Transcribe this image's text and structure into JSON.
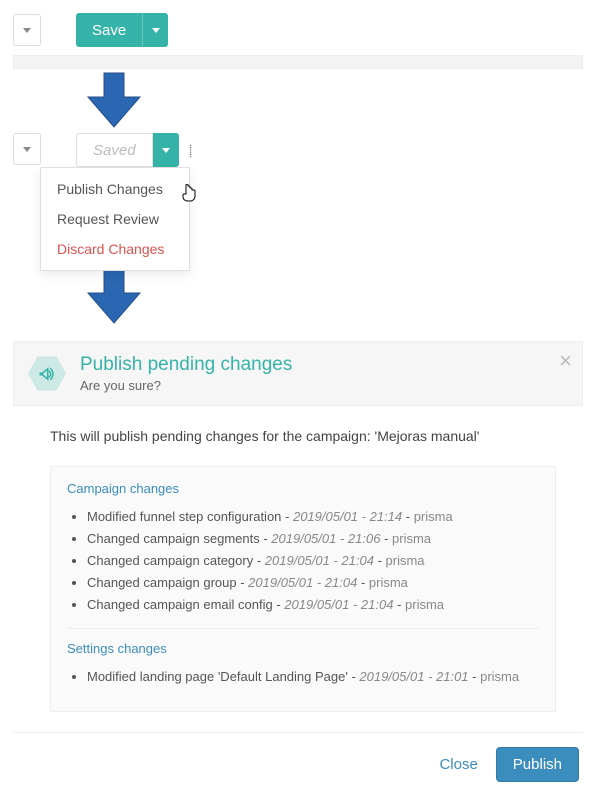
{
  "toolbar1": {
    "save_label": "Save"
  },
  "toolbar2": {
    "saved_label": "Saved"
  },
  "dropdown": {
    "publish": "Publish Changes",
    "review": "Request Review",
    "discard": "Discard Changes"
  },
  "modal": {
    "title": "Publish pending changes",
    "subtitle": "Are you sure?",
    "body_text": "This will publish pending changes for the campaign: 'Mejoras manual'",
    "campaign_section": "Campaign changes",
    "settings_section": "Settings changes",
    "campaign_changes": [
      {
        "desc": "Modified funnel step configuration",
        "ts": "2019/05/01 - 21:14",
        "user": "prisma"
      },
      {
        "desc": "Changed campaign segments",
        "ts": "2019/05/01 - 21:06",
        "user": "prisma"
      },
      {
        "desc": "Changed campaign category",
        "ts": "2019/05/01 - 21:04",
        "user": "prisma"
      },
      {
        "desc": "Changed campaign group",
        "ts": "2019/05/01 - 21:04",
        "user": "prisma"
      },
      {
        "desc": "Changed campaign email config",
        "ts": "2019/05/01 - 21:04",
        "user": "prisma"
      }
    ],
    "settings_changes": [
      {
        "desc": "Modified landing page 'Default Landing Page'",
        "ts": "2019/05/01 - 21:01",
        "user": "prisma"
      }
    ],
    "close": "Close",
    "publish": "Publish"
  }
}
